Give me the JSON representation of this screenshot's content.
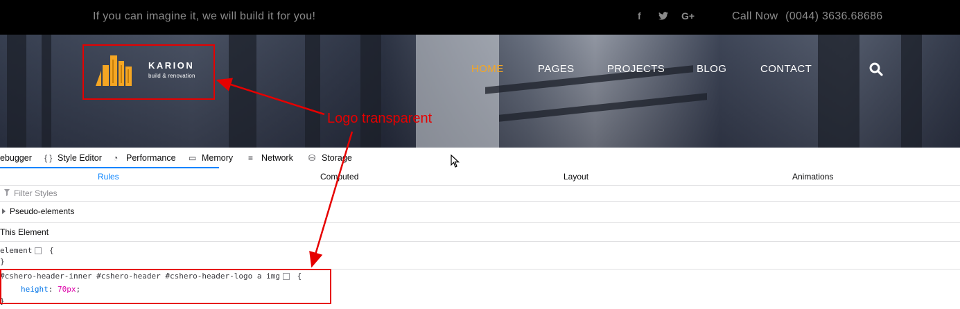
{
  "topbar": {
    "tagline": "If you can imagine it, we will build it for you!",
    "social": [
      {
        "icon": "facebook-icon",
        "glyph": "f"
      },
      {
        "icon": "twitter-icon",
        "glyph": "𝕥"
      },
      {
        "icon": "google-plus-icon",
        "glyph": "G+"
      }
    ],
    "call_label": "Call Now",
    "call_number": "(0044) 3636.68686"
  },
  "header": {
    "brand_name": "KARION",
    "brand_tagline": "build & renovation",
    "logo_color": "#f5a623",
    "nav": [
      {
        "label": "HOME",
        "active": true
      },
      {
        "label": "PAGES",
        "active": false
      },
      {
        "label": "PROJECTS",
        "active": false
      },
      {
        "label": "BLOG",
        "active": false
      },
      {
        "label": "CONTACT",
        "active": false
      }
    ],
    "search_icon": "search-icon"
  },
  "annotation": {
    "label": "Logo transparent",
    "color": "#e60000"
  },
  "devtools": {
    "tools": [
      {
        "label": "ebugger",
        "icon": ""
      },
      {
        "label": "Style Editor",
        "icon": "braces-icon"
      },
      {
        "label": "Performance",
        "icon": "gauge-icon"
      },
      {
        "label": "Memory",
        "icon": "memory-chip-icon"
      },
      {
        "label": "Network",
        "icon": "network-icon"
      },
      {
        "label": "Storage",
        "icon": "database-icon"
      }
    ],
    "subtabs": [
      {
        "label": "Rules",
        "active": true
      },
      {
        "label": "Computed",
        "active": false
      },
      {
        "label": "Layout",
        "active": false
      },
      {
        "label": "Animations",
        "active": false
      }
    ],
    "filter_placeholder": "Filter Styles",
    "pseudo_elements": "Pseudo-elements",
    "this_element": "This Element",
    "rules": [
      {
        "selector": "element",
        "open": "{",
        "close": "}",
        "declarations": []
      },
      {
        "selector": "#cshero-header-inner #cshero-header #cshero-header-logo a img",
        "open": "{",
        "close": "}",
        "declarations": [
          {
            "property": "height",
            "value": "70px"
          }
        ]
      }
    ]
  }
}
